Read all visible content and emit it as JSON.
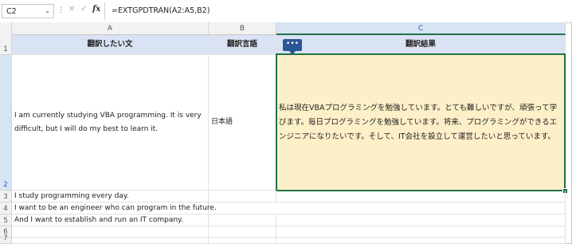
{
  "formula_bar": {
    "name_box": "C2",
    "name_box_dropdown": "⌄",
    "more_dots": "⋮",
    "cancel_icon": "✕",
    "confirm_icon": "✓",
    "fx_label": "fx",
    "formula": "=EXTGPDTRAN(A2:A5,B2)"
  },
  "columns": [
    {
      "letter": "A",
      "header": "翻訳したい文"
    },
    {
      "letter": "B",
      "header": "翻訳言語"
    },
    {
      "letter": "C",
      "header": "翻訳結果"
    }
  ],
  "rows": [
    "1",
    "2",
    "3",
    "4",
    "5",
    "6",
    "7"
  ],
  "cells": {
    "A2": "I am currently studying VBA programming. It is very difficult, but I will do my best to learn it.",
    "B2": "日本語",
    "C2": "私は現在VBAプログラミングを勉強しています。とても難しいですが、頑張って学びます。毎日プログラミングを勉強しています。将来、プログラミングができるエンジニアになりたいです。そして、IT会社を設立して運営したいと思っています。",
    "A3": "I study programming every day.",
    "A4": "I want to be an engineer who can program in the future.",
    "A5": "And I want to establish and run an IT company."
  },
  "tag_label": "•••",
  "colors": {
    "header_fill": "#dae3f3",
    "result_fill": "#fdf0c8",
    "selection": "#217346",
    "tag": "#2b5797"
  }
}
